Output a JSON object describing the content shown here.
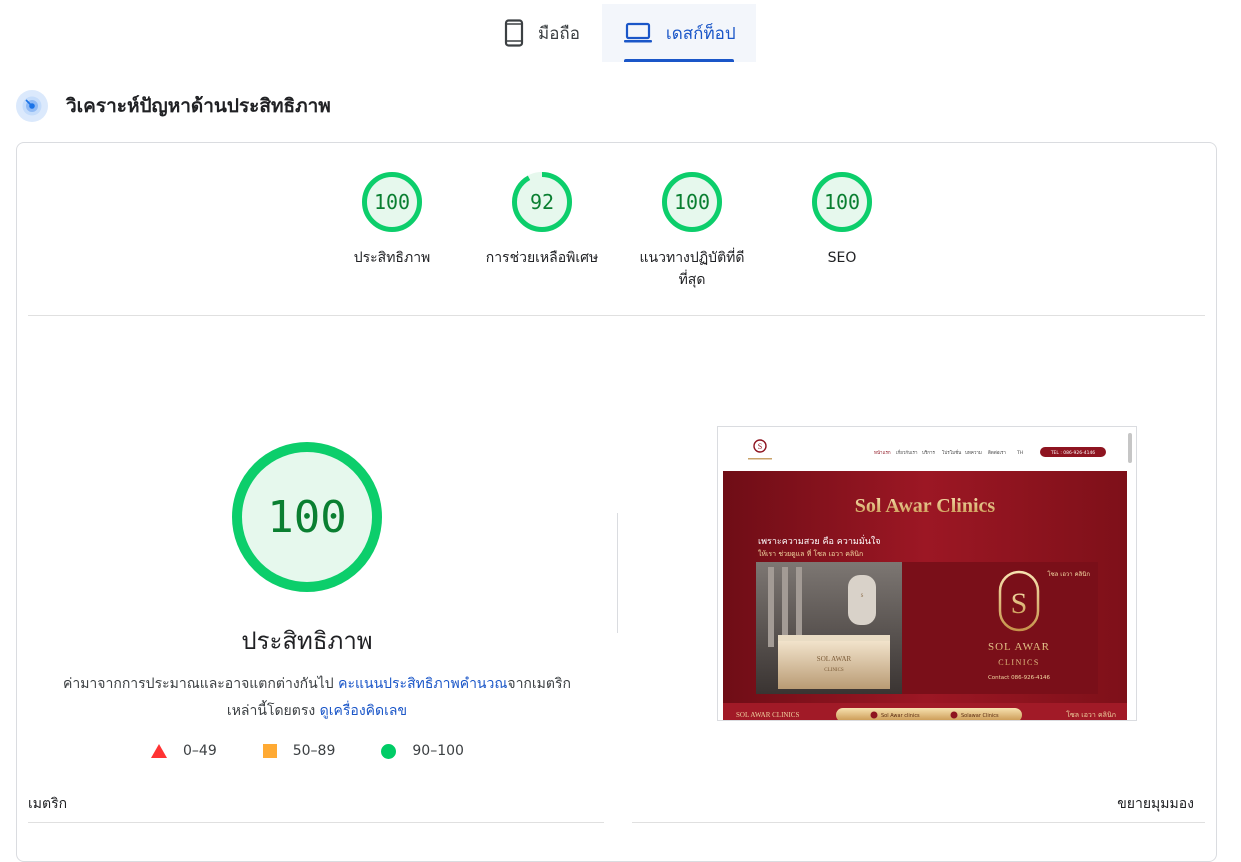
{
  "device_tabs": [
    {
      "label": "มือถือ",
      "icon": "smartphone-icon",
      "active": false
    },
    {
      "label": "เดสก์ท็อป",
      "icon": "laptop-icon",
      "active": true
    }
  ],
  "section": {
    "title": "วิเคราะห์ปัญหาด้านประสิทธิภาพ",
    "icon": "radar-icon"
  },
  "categories": [
    {
      "label": "ประสิทธิภาพ",
      "score": 100
    },
    {
      "label": "การช่วยเหลือพิเศษ",
      "score": 92
    },
    {
      "label": "แนวทางปฏิบัติที่ดีที่สุด",
      "score": 100
    },
    {
      "label": "SEO",
      "score": 100
    }
  ],
  "performance": {
    "score": 100,
    "title": "ประสิทธิภาพ",
    "desc_prefix": "ค่ามาจากการประมาณและอาจแตกต่างกันไป ",
    "desc_link1": "คะแนนประสิทธิภาพคำนวณ",
    "desc_middle": "จากเมตริกเหล่านี้โดยตรง ",
    "desc_link2": "ดูเครื่องคิดเลข"
  },
  "legend": [
    {
      "range": "0–49",
      "shape": "triangle",
      "color": "#f33"
    },
    {
      "range": "50–89",
      "shape": "square",
      "color": "#fa3"
    },
    {
      "range": "90–100",
      "shape": "circle",
      "color": "#0c6"
    }
  ],
  "screenshot": {
    "nav": [
      "หน้าแรก",
      "เกี่ยวกับเรา",
      "บริการ",
      "โปรโมชั่น",
      "บทความ",
      "ติดต่อเรา",
      "TH"
    ],
    "phone": "TEL : 086-926-4146",
    "hero_title": "Sol Awar Clinics",
    "tagline": "เพราะความสวย คือ ความมั่นใจ",
    "subtagline": "ให้เรา ช่วยดูแล ที่ โซล เอวา คลินิก",
    "brand_th": "โซล เอวา คลินิก",
    "brand_line1": "SOL AWAR",
    "brand_line2": "CLINICS",
    "contact": "Contact  086-926-4146",
    "footer_left": "SOL AWAR CLINICS",
    "footer_fb": "Sol Awar clinics",
    "footer_ig": "Solawar Clinics",
    "footer_right": "โซล เอวา คลินิก"
  },
  "colors": {
    "pass": "#0cce6b",
    "pass_text": "#0a7f31",
    "pass_fill": "#e6f8ed",
    "brand_red": "#8e1420",
    "gold": "#e9c47c",
    "accent": "#1a56c8"
  },
  "metrics": {
    "label": "เมตริก",
    "expand": "ขยายมุมมอง"
  }
}
